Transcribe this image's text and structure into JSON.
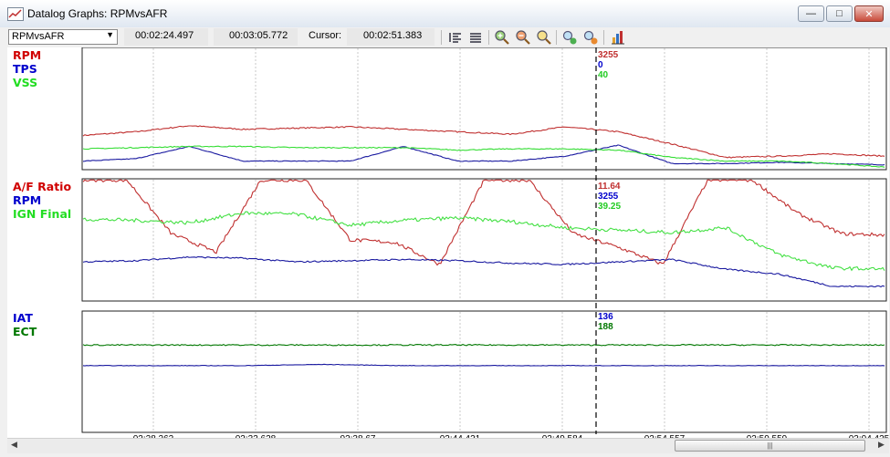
{
  "window": {
    "title": "Datalog Graphs: RPMvsAFR",
    "minimize_label": "—",
    "maximize_label": "□",
    "close_label": "✕"
  },
  "toolbar": {
    "selected_log": "RPMvsAFR",
    "start_time": "00:02:24.497",
    "end_time": "00:03:05.772",
    "cursor_label": "Cursor:",
    "cursor_time": "00:02:51.383",
    "icons": [
      "align-left-icon",
      "align-justify-icon",
      "zoom-in-icon",
      "zoom-out-icon",
      "zoom-fit-icon",
      "add-graph-icon",
      "remove-graph-icon",
      "chart-settings-icon"
    ]
  },
  "panels": [
    {
      "legend": [
        {
          "name": "RPM",
          "color": "#d00000"
        },
        {
          "name": "TPS",
          "color": "#0000cc"
        },
        {
          "name": "VSS",
          "color": "#22dd22"
        }
      ],
      "cursor_values": [
        {
          "value": "3255",
          "color": "#c03030"
        },
        {
          "value": "0",
          "color": "#0000cc"
        },
        {
          "value": "40",
          "color": "#22cc22"
        }
      ]
    },
    {
      "legend": [
        {
          "name": "A/F Ratio",
          "color": "#d00000"
        },
        {
          "name": "RPM",
          "color": "#0000cc"
        },
        {
          "name": "IGN Final",
          "color": "#22dd22"
        }
      ],
      "cursor_values": [
        {
          "value": "11.64",
          "color": "#c03030"
        },
        {
          "value": "3255",
          "color": "#0000cc"
        },
        {
          "value": "39.25",
          "color": "#22cc22"
        }
      ]
    },
    {
      "legend": [
        {
          "name": "IAT",
          "color": "#0000cc"
        },
        {
          "name": "ECT",
          "color": "#007700"
        }
      ],
      "cursor_values": [
        {
          "value": "136",
          "color": "#0000cc"
        },
        {
          "value": "188",
          "color": "#007700"
        }
      ]
    }
  ],
  "time_axis": {
    "tick_labels": [
      "02:28.262",
      "02:33.628",
      "02:38.67",
      "02:44.421",
      "02:49.584",
      "02:54.557",
      "02:59.559",
      "03:04.425"
    ]
  },
  "scrollbar": {
    "grip": "|||",
    "left_arrow": "◀",
    "right_arrow": "▶"
  },
  "chart_data": {
    "type": "line",
    "x_range": [
      "00:02:24.497",
      "00:03:05.772"
    ],
    "cursor_x": "00:02:51.383",
    "panels": [
      {
        "series": [
          {
            "name": "RPM",
            "color": "#c03030",
            "y": [
              0.28,
              0.31,
              0.36,
              0.33,
              0.34,
              0.35,
              0.33,
              0.31,
              0.29,
              0.35,
              0.31,
              0.21,
              0.1,
              0.11,
              0.13,
              0.11
            ]
          },
          {
            "name": "TPS",
            "color": "#1a1aa0",
            "y": [
              0.07,
              0.09,
              0.19,
              0.07,
              0.07,
              0.07,
              0.19,
              0.07,
              0.07,
              0.11,
              0.2,
              0.05,
              0.05,
              0.06,
              0.05,
              0.04
            ]
          },
          {
            "name": "VSS",
            "color": "#33dd33",
            "y": [
              0.17,
              0.18,
              0.19,
              0.19,
              0.18,
              0.18,
              0.18,
              0.16,
              0.17,
              0.17,
              0.16,
              0.1,
              0.07,
              0.07,
              0.05,
              0.02
            ]
          }
        ]
      },
      {
        "series": [
          {
            "name": "A/F Ratio",
            "color": "#c03030",
            "y": [
              0.99,
              0.99,
              0.55,
              0.4,
              0.99,
              0.99,
              0.5,
              0.48,
              0.3,
              0.99,
              0.99,
              0.55,
              0.44,
              0.3,
              0.99,
              0.99,
              0.72,
              0.55,
              0.54
            ]
          },
          {
            "name": "RPM",
            "color": "#1a1aa0",
            "y": [
              0.32,
              0.33,
              0.36,
              0.35,
              0.32,
              0.33,
              0.34,
              0.33,
              0.31,
              0.3,
              0.32,
              0.34,
              0.26,
              0.22,
              0.12,
              0.12
            ]
          },
          {
            "name": "IGN Final",
            "color": "#44e044",
            "y": [
              0.67,
              0.66,
              0.64,
              0.72,
              0.71,
              0.62,
              0.66,
              0.68,
              0.65,
              0.6,
              0.58,
              0.56,
              0.6,
              0.38,
              0.27,
              0.26
            ]
          }
        ]
      },
      {
        "series": [
          {
            "name": "IAT",
            "color": "#1a1aa0",
            "y": [
              0.55,
              0.55,
              0.55,
              0.56,
              0.55,
              0.55,
              0.55,
              0.55,
              0.55,
              0.55,
              0.55
            ]
          },
          {
            "name": "ECT",
            "color": "#007700",
            "y": [
              0.72,
              0.72,
              0.72,
              0.72,
              0.72,
              0.72,
              0.72,
              0.72,
              0.72,
              0.72,
              0.72
            ]
          }
        ]
      }
    ]
  }
}
